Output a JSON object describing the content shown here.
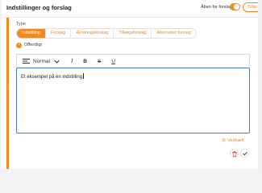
{
  "header": {
    "title": "Indstillinger og forslag",
    "open_for_suggestions_label": "Åben for forslag",
    "toggle_on": true,
    "add_button_label": "Tilføj +"
  },
  "type_section": {
    "label": "Type",
    "options": [
      {
        "label": "Indstilling",
        "active": true
      },
      {
        "label": "Forslag",
        "active": false
      },
      {
        "label": "Ændringsforslag",
        "active": false
      },
      {
        "label": "Tillægsforslag",
        "active": false
      },
      {
        "label": "Alternativt forslag",
        "active": false
      }
    ],
    "selected": "Indstilling"
  },
  "public": {
    "label": "Offentligt",
    "checked": true
  },
  "toolbar": {
    "style_label": "Normal",
    "italic": "I",
    "bold": "B",
    "strike": "S",
    "underline": "U"
  },
  "editor": {
    "content": "Et eksempel på en indstilling"
  },
  "attach_label": "Vedhæft",
  "colors": {
    "accent": "#f08a24",
    "focus": "#4a77c9",
    "danger": "#e05a4a"
  },
  "icons": [
    "drag-handle-icon",
    "check-icon",
    "align-icon",
    "chevron-down-icon",
    "paperclip-icon",
    "trash-icon",
    "checkmark-icon"
  ]
}
